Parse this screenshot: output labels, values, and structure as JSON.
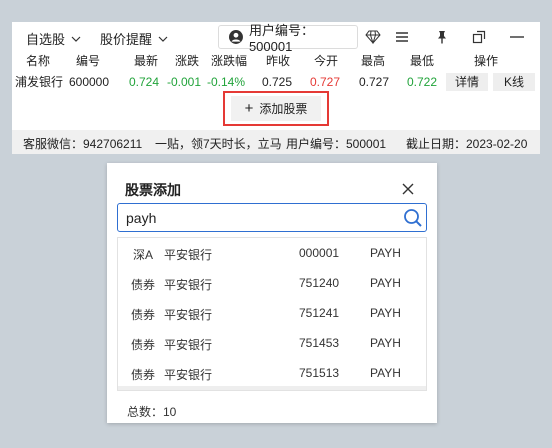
{
  "topbar": {
    "watchlist_label": "自选股",
    "alert_label": "股价提醒",
    "user_label": "用户编号：500001"
  },
  "table": {
    "headers": [
      "名称",
      "编号",
      "最新",
      "涨跌",
      "涨跌幅",
      "昨收",
      "今开",
      "最高",
      "最低",
      "操作"
    ],
    "row": {
      "name": "浦发银行",
      "code": "600000",
      "latest": "0.724",
      "change": "-0.001",
      "change_pct": "-0.14%",
      "prev_close": "0.725",
      "open": "0.727",
      "high": "0.727",
      "low": "0.722",
      "detail_label": "详情",
      "kline_label": "K线"
    },
    "add_button_label": "添加股票"
  },
  "footer": {
    "wechat": "客服微信：942706211",
    "promo": "一贴，领7天时长，立马",
    "user": "用户编号：500001",
    "expiry": "截止日期：2023-02-20"
  },
  "dialog": {
    "title": "股票添加",
    "search_value": "payh",
    "results": [
      {
        "market": "深A",
        "name": "平安银行",
        "code": "000001",
        "abbr": "PAYH"
      },
      {
        "market": "债券",
        "name": "平安银行",
        "code": "751240",
        "abbr": "PAYH"
      },
      {
        "market": "债券",
        "name": "平安银行",
        "code": "751241",
        "abbr": "PAYH"
      },
      {
        "market": "债券",
        "name": "平安银行",
        "code": "751453",
        "abbr": "PAYH"
      },
      {
        "market": "债券",
        "name": "平安银行",
        "code": "751513",
        "abbr": "PAYH"
      }
    ],
    "total_label": "总数：10"
  },
  "colors": {
    "down": "#21a33a",
    "up": "#e53935",
    "highlight": "#e53935",
    "focus": "#2f6fd1"
  }
}
